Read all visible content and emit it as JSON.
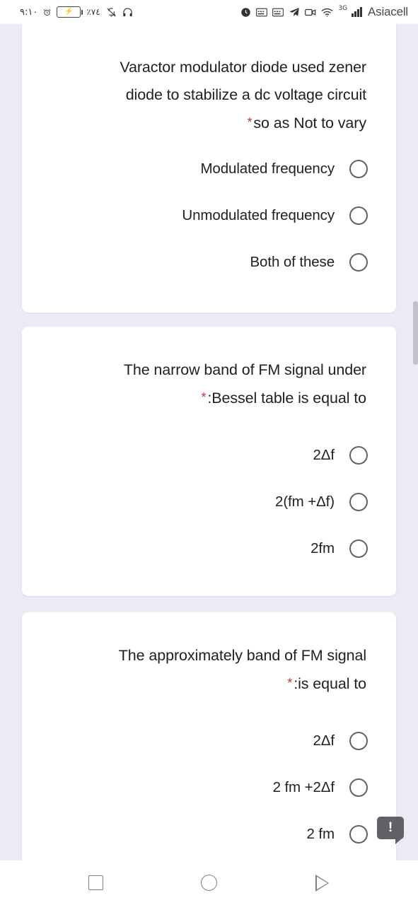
{
  "status_bar": {
    "time": "٩:١٠",
    "battery_percent": "٪٧٤",
    "battery_icon": "battery-charging-icon",
    "mute_icon": "notifications-off-icon",
    "headphones_icon": "headphones-icon",
    "alarm_icon": "alarm-icon",
    "keyboard_icon_1": "keyboard-icon",
    "keyboard_icon_2": "keyboard-icon",
    "telegram_icon": "telegram-icon",
    "video_icon": "video-camera-icon",
    "wifi_icon": "wifi-icon",
    "network_generation": "3G",
    "signal_icon": "signal-bars-icon",
    "carrier": "Asiacell"
  },
  "form": {
    "cards": [
      {
        "question": "Varactor modulator diode used zener diode to stabilize a dc voltage circuit so as Not to vary",
        "question_line_1": "Varactor modulator diode used zener",
        "question_line_2": "diode to stabilize a dc voltage circuit",
        "question_line_3": "so as Not to vary",
        "required_marker": "*",
        "options": [
          {
            "label": "Modulated frequency",
            "selected": false
          },
          {
            "label": "Unmodulated frequency",
            "selected": false
          },
          {
            "label": "Both of these",
            "selected": false
          }
        ]
      },
      {
        "question": "The narrow band of FM signal under Bessel table is equal to:",
        "question_line_1": "The narrow band of FM signal under",
        "question_line_2": ":Bessel table is equal to",
        "required_marker": "*",
        "options": [
          {
            "label": "2Δf",
            "selected": false
          },
          {
            "label": "2(fm +Δf)",
            "selected": false
          },
          {
            "label": "2fm",
            "selected": false
          }
        ]
      },
      {
        "question": "The approximately band of FM signal is equal to:",
        "question_line_1": "The approximately band of FM signal",
        "question_line_2": ":is equal to",
        "required_marker": "*",
        "options": [
          {
            "label": "2Δf",
            "selected": false
          },
          {
            "label": "2 fm +2Δf",
            "selected": false
          },
          {
            "label": "2 fm",
            "selected": false
          }
        ]
      }
    ]
  },
  "help_badge": {
    "icon": "exclamation-icon",
    "glyph": "!"
  },
  "nav_bar": {
    "recents_icon": "square-recents-icon",
    "home_icon": "circle-home-icon",
    "back_icon": "triangle-back-icon"
  },
  "colors": {
    "page_background": "#eceaf5",
    "card_background": "#ffffff",
    "text": "#202124",
    "required_asterisk": "#b83b2c",
    "radio_border": "#5f6368",
    "scrollbar_thumb": "#c3c1c8",
    "badge_background": "#5f6166",
    "nav_icon": "#808089"
  }
}
